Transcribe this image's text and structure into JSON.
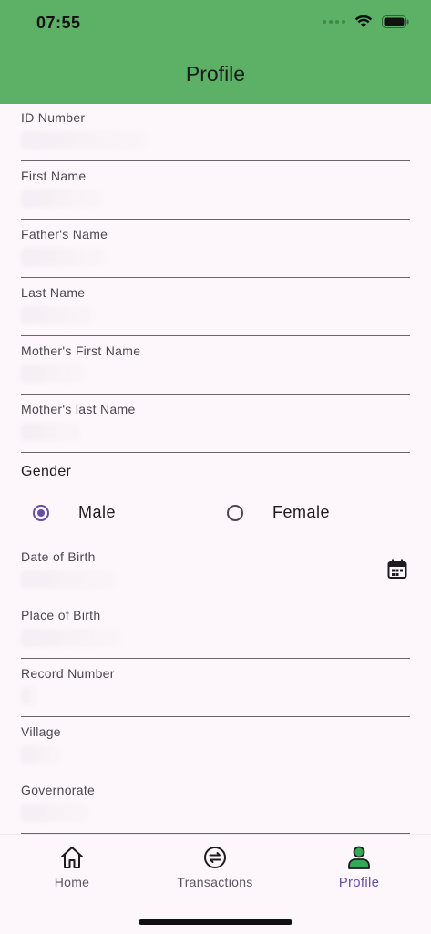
{
  "status_bar": {
    "time": "07:55"
  },
  "header": {
    "title": "Profile"
  },
  "fields": [
    {
      "label": "ID Number",
      "value": ""
    },
    {
      "label": "First Name",
      "value": ""
    },
    {
      "label": "Father's Name",
      "value": ""
    },
    {
      "label": "Last Name",
      "value": ""
    },
    {
      "label": "Mother's First Name",
      "value": ""
    },
    {
      "label": "Mother's last Name",
      "value": ""
    }
  ],
  "gender": {
    "label": "Gender",
    "options": [
      {
        "label": "Male",
        "selected": true
      },
      {
        "label": "Female",
        "selected": false
      }
    ]
  },
  "date_of_birth": {
    "label": "Date of Birth",
    "value": ""
  },
  "fields_lower": [
    {
      "label": "Place of Birth",
      "value": ""
    },
    {
      "label": "Record Number",
      "value": ""
    },
    {
      "label": "Village",
      "value": ""
    },
    {
      "label": "Governorate",
      "value": ""
    }
  ],
  "bottom_nav": {
    "items": [
      {
        "label": "Home",
        "icon": "home-icon",
        "active": false
      },
      {
        "label": "Transactions",
        "icon": "transactions-icon",
        "active": false
      },
      {
        "label": "Profile",
        "icon": "profile-icon",
        "active": true
      }
    ]
  },
  "colors": {
    "header_bg": "#5db166",
    "accent": "#6750a4",
    "profile_icon": "#34a853"
  }
}
